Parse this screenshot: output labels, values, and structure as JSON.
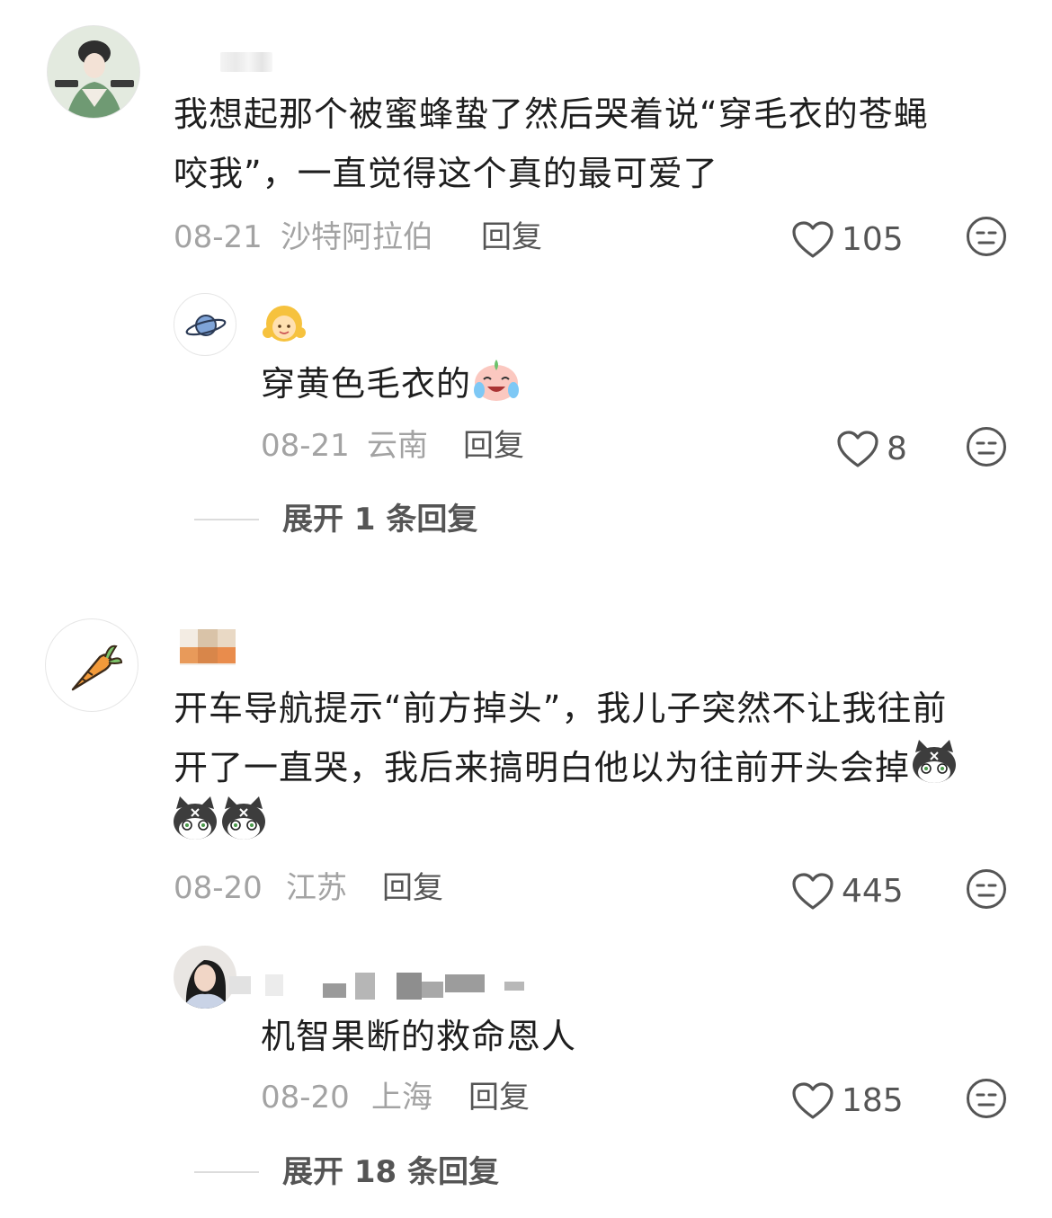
{
  "comments": [
    {
      "text_line1": "我想起那个被蜜蜂蛰了然后哭着说“穿毛衣的苍蝇",
      "text_line2": "咬我”，一直觉得这个真的最可爱了",
      "date": "08-21",
      "location": "沙特阿拉伯",
      "reply_label": "回复",
      "likes": "105",
      "reply": {
        "text": "穿黄色毛衣的",
        "date": "08-21",
        "location": "云南",
        "reply_label": "回复",
        "likes": "8"
      },
      "expand_label": "展开 1 条回复"
    },
    {
      "text_line1": "开车导航提示“前方掉头”，我儿子突然不让我往前",
      "text_line2": "开了一直哭，我后来搞明白他以为往前开头会掉",
      "date": "08-20",
      "location": "江苏",
      "reply_label": "回复",
      "likes": "445",
      "reply": {
        "text": "机智果断的救命恩人",
        "date": "08-20",
        "location": "上海",
        "reply_label": "回复",
        "likes": "185"
      },
      "expand_label": "展开 18 条回复"
    }
  ],
  "icons": {
    "like": "heart-outline-icon",
    "dislike": "meh-face-icon",
    "avatar1": "woman-illustration-avatar",
    "avatar2": "saturn-planet-avatar",
    "avatar3": "carrot-avatar",
    "avatar4": "woman-photo-avatar"
  },
  "colors": {
    "meta": "#a3a3a3",
    "text": "#1e1e1e",
    "icon": "#555555"
  }
}
